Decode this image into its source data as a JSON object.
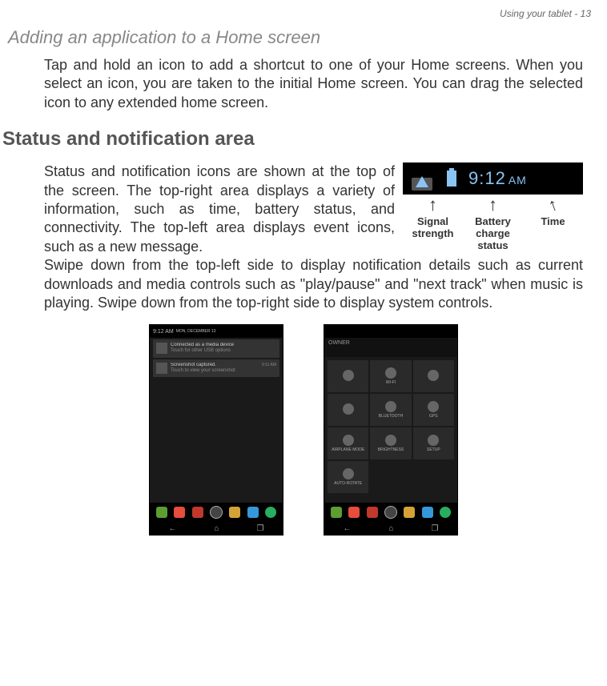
{
  "header": {
    "page_label": "Using your tablet - 13"
  },
  "section1": {
    "title": "Adding an application to a Home screen",
    "body": "Tap and hold an icon to add a shortcut to one of your Home screens. When you select an icon, you are taken to the initial Home screen. You can drag the selected icon to any extended home screen."
  },
  "section2": {
    "title": "Status and notification area",
    "body1": "Status and notification icons are shown at the top of the screen. The top-right area displays a variety of information, such as time, battery status, and connectivity. The top-left area displays event icons, such as a new message.",
    "body2": "Swipe down from the top-left side to display notification details such as current downloads and media controls such as \"play/pause\" and \"next track\" when music is playing. Swipe down from the top-right side to display system controls."
  },
  "status_bar": {
    "time": "9:12",
    "ampm": "AM",
    "labels": {
      "signal": "Signal strength",
      "battery": "Battery charge status",
      "time": "Time"
    }
  },
  "screenshot_left": {
    "status_time": "9:12 AM",
    "status_date": "MON, DECEMBER 13",
    "notifications": [
      {
        "title": "Connected as a media device",
        "subtitle": "Touch for other USB options"
      },
      {
        "title": "Screenshot captured.",
        "subtitle": "Touch to view your screenshot",
        "time": "9:11 AM"
      }
    ]
  },
  "screenshot_right": {
    "header": "OWNER",
    "tiles": [
      {
        "label": ""
      },
      {
        "label": "WI-FI"
      },
      {
        "label": ""
      },
      {
        "label": ""
      },
      {
        "label": "BLUETOOTH"
      },
      {
        "label": "GPS"
      },
      {
        "label": "AIRPLANE MODE"
      },
      {
        "label": "BRIGHTNESS"
      },
      {
        "label": "SETUP"
      },
      {
        "label": "AUTO-ROTATE"
      }
    ]
  },
  "dock_colors": [
    "#5c9e31",
    "#e74c3c",
    "#c0392b",
    "#444",
    "#d4a337",
    "#3498db",
    "#27ae60"
  ]
}
